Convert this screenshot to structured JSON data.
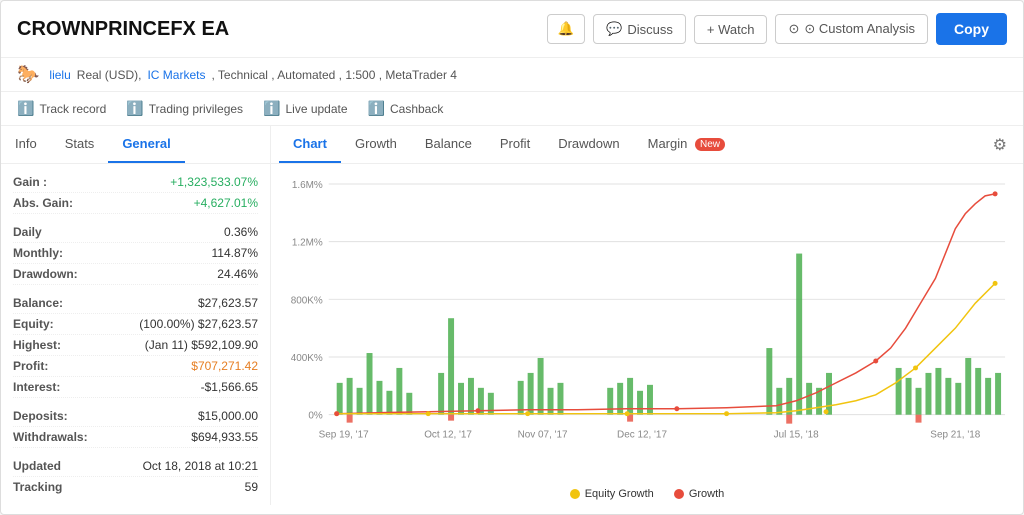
{
  "header": {
    "title": "CROWNPRINCEFX EA",
    "bell_label": "🔔",
    "discuss_label": "Discuss",
    "watch_label": "+ Watch",
    "custom_analysis_label": "⊙ Custom Analysis",
    "copy_label": "Copy"
  },
  "subheader": {
    "user": "lielu",
    "account_type": "Real (USD),",
    "broker": "IC Markets",
    "details": ", Technical , Automated , 1:500 , MetaTrader 4"
  },
  "trackbar": {
    "items": [
      {
        "id": "track-record",
        "label": "Track record"
      },
      {
        "id": "trading-privileges",
        "label": "Trading privileges"
      },
      {
        "id": "live-update",
        "label": "Live update"
      },
      {
        "id": "cashback",
        "label": "Cashback"
      }
    ]
  },
  "left_panel": {
    "tabs": [
      {
        "id": "info",
        "label": "Info",
        "active": false
      },
      {
        "id": "stats",
        "label": "Stats",
        "active": false
      },
      {
        "id": "general",
        "label": "General",
        "active": true
      }
    ],
    "info": {
      "gain_label": "Gain :",
      "gain_value": "+1,323,533.07%",
      "abs_gain_label": "Abs. Gain:",
      "abs_gain_value": "+4,627.01%",
      "daily_label": "Daily",
      "daily_value": "0.36%",
      "monthly_label": "Monthly:",
      "monthly_value": "114.87%",
      "drawdown_label": "Drawdown:",
      "drawdown_value": "24.46%",
      "balance_label": "Balance:",
      "balance_value": "$27,623.57",
      "equity_label": "Equity:",
      "equity_value": "(100.00%) $27,623.57",
      "highest_label": "Highest:",
      "highest_value": "(Jan 11) $592,109.90",
      "profit_label": "Profit:",
      "profit_value": "$707,271.42",
      "interest_label": "Interest:",
      "interest_value": "-$1,566.65",
      "deposits_label": "Deposits:",
      "deposits_value": "$15,000.00",
      "withdrawals_label": "Withdrawals:",
      "withdrawals_value": "$694,933.55",
      "updated_label": "Updated",
      "updated_value": "Oct 18, 2018 at 10:21",
      "tracking_label": "Tracking",
      "tracking_value": "59"
    }
  },
  "right_panel": {
    "tabs": [
      {
        "id": "chart",
        "label": "Chart",
        "active": true
      },
      {
        "id": "growth",
        "label": "Growth",
        "active": false
      },
      {
        "id": "balance",
        "label": "Balance",
        "active": false
      },
      {
        "id": "profit",
        "label": "Profit",
        "active": false
      },
      {
        "id": "drawdown",
        "label": "Drawdown",
        "active": false
      },
      {
        "id": "margin",
        "label": "Margin",
        "active": false,
        "badge": "New"
      }
    ],
    "chart": {
      "y_labels": [
        "1.6M%",
        "1.2M%",
        "800K%",
        "400K%",
        "0%"
      ],
      "x_labels": [
        "Sep 19, '17",
        "Oct 12, '17",
        "Nov 07, '17",
        "Dec 12, '17",
        "Jul 15, '18",
        "Sep 21, '18"
      ],
      "legend": {
        "equity_growth": "Equity Growth",
        "growth": "Growth"
      }
    }
  }
}
